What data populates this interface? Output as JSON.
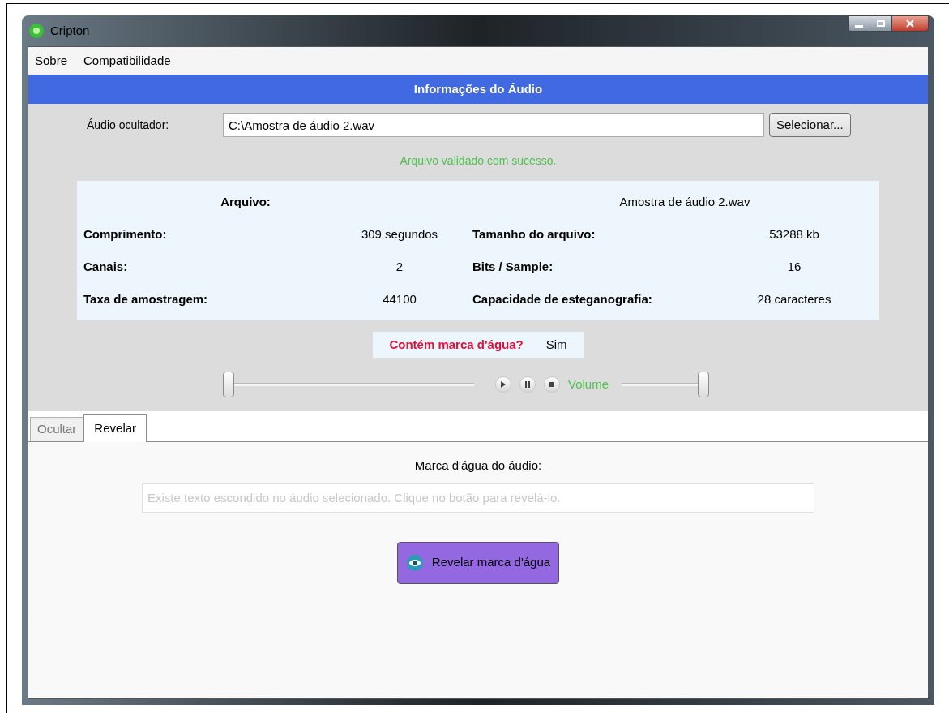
{
  "window": {
    "title": "Cripton"
  },
  "menu": [
    "Sobre",
    "Compatibilidade"
  ],
  "header": "Informações do Áudio",
  "file_row": {
    "label": "Áudio ocultador:",
    "value": "C:\\Amostra de áudio 2.wav",
    "button": "Selecionar..."
  },
  "status": "Arquivo validado com sucesso.",
  "info": {
    "file_label": "Arquivo:",
    "file_value": "Amostra de áudio 2.wav",
    "rows": [
      {
        "label": "Comprimento:",
        "value": "309 segundos",
        "label2": "Tamanho do arquivo:",
        "value2": "53288 kb"
      },
      {
        "label": "Canais:",
        "value": "2",
        "label2": "Bits / Sample:",
        "value2": "16"
      },
      {
        "label": "Taxa de amostragem:",
        "value": "44100",
        "label2": "Capacidade de esteganografia:",
        "value2": "28 caracteres"
      }
    ]
  },
  "watermark": {
    "label": "Contém marca d'água?",
    "value": "Sim"
  },
  "player": {
    "position": {
      "level": 0
    },
    "volume_label": "Volume",
    "volume": {
      "level": 1
    }
  },
  "tabs": [
    {
      "label": "Ocultar",
      "selected": false
    },
    {
      "label": "Revelar",
      "selected": true
    }
  ],
  "reveal": {
    "label": "Marca d'água do áudio:",
    "placeholder": "Existe texto escondido no áudio selecionado. Clique no botão para revelá-lo.",
    "button": "Revelar marca d'água"
  }
}
